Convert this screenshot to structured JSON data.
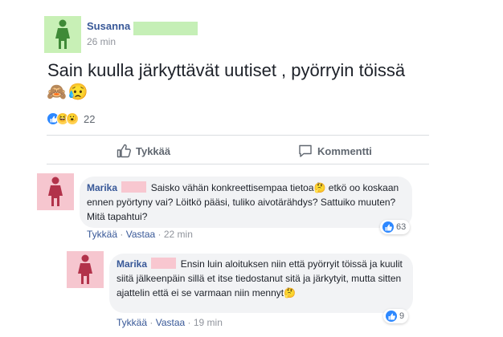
{
  "post": {
    "author": "Susanna",
    "time": "26 min",
    "text": "Sain kuulla järkyttävät uutiset , pyörryin töissä",
    "emojis": [
      "🙈",
      "😥"
    ],
    "reactions": {
      "icons": [
        "like",
        "haha",
        "wow"
      ],
      "count": "22"
    },
    "actions": {
      "like": "Tykkää",
      "comment": "Kommentti"
    }
  },
  "comments": [
    {
      "author": "Marika",
      "text_part1": "Saisko vähän konkreettisempaa tietoa",
      "emoji": "🤔",
      "text_part2": " etkö oo koskaan ennen pyörtyny vai? Löitkö pääsi, tuliko aivotärähdys? Sattuiko muuten? Mitä tapahtui?",
      "like_link": "Tykkää",
      "reply_link": "Vastaa",
      "separator": "·",
      "time": "22 min",
      "likes": "63"
    },
    {
      "author": "Marika",
      "text_part1": "Ensin luin aloituksen niin että pyörryit töissä ja kuulit siitä jälkeenpäin sillä et itse tiedostanut sitä ja järkytyit, mutta sitten ajattelin että ei se varmaan niin mennyt",
      "emoji": "🤔",
      "like_link": "Tykkää",
      "reply_link": "Vastaa",
      "separator": "·",
      "time": "19 min",
      "likes": "9"
    }
  ],
  "colors": {
    "link": "#385898",
    "like_blue": "#2d88ff",
    "avatar_green": "#c8f0b6",
    "avatar_pink": "#f6c6cf",
    "bubble": "#f2f3f5"
  },
  "icons": {
    "female_avatar": "female-figure-icon",
    "like": "thumbs-up-icon",
    "comment": "speech-bubble-icon"
  }
}
